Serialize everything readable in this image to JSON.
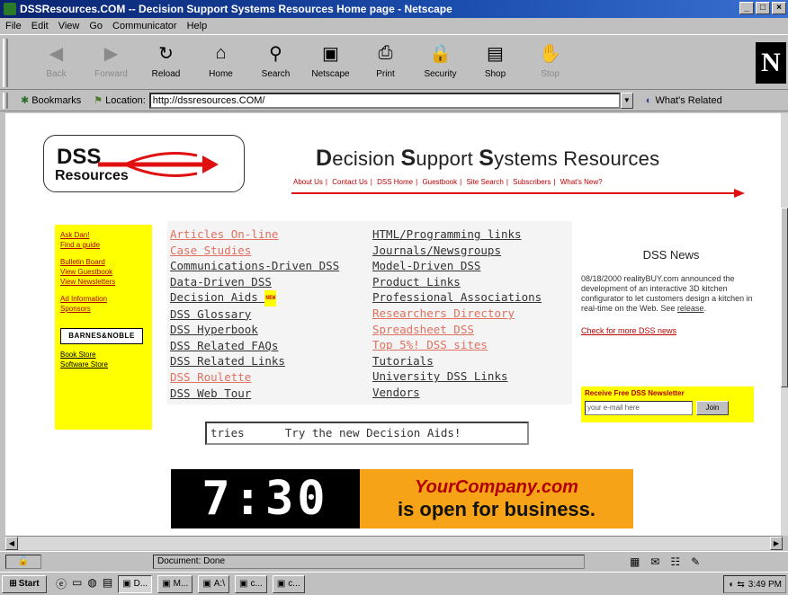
{
  "window": {
    "title": "DSSResources.COM -- Decision Support Systems Resources Home page - Netscape",
    "buttons": [
      "_",
      "□",
      "×"
    ]
  },
  "menu": [
    "File",
    "Edit",
    "View",
    "Go",
    "Communicator",
    "Help"
  ],
  "toolbar": {
    "items": [
      {
        "label": "Back",
        "icon": "back-arrow-icon",
        "glyph": "◀",
        "disabled": true
      },
      {
        "label": "Forward",
        "icon": "forward-arrow-icon",
        "glyph": "▶",
        "disabled": true
      },
      {
        "label": "Reload",
        "icon": "reload-icon",
        "glyph": "↻",
        "disabled": false
      },
      {
        "label": "Home",
        "icon": "home-icon",
        "glyph": "⌂",
        "disabled": false
      },
      {
        "label": "Search",
        "icon": "search-icon",
        "glyph": "⚲",
        "disabled": false
      },
      {
        "label": "Netscape",
        "icon": "netscape-icon",
        "glyph": "▣",
        "disabled": false
      },
      {
        "label": "Print",
        "icon": "print-icon",
        "glyph": "⎙",
        "disabled": false
      },
      {
        "label": "Security",
        "icon": "lock-icon",
        "glyph": "🔒",
        "disabled": false
      },
      {
        "label": "Shop",
        "icon": "shop-icon",
        "glyph": "▤",
        "disabled": false
      },
      {
        "label": "Stop",
        "icon": "stop-icon",
        "glyph": "✋",
        "disabled": true
      }
    ],
    "brand": "N"
  },
  "location": {
    "bookmarks_label": "Bookmarks",
    "location_label": "Location:",
    "url": "http://dssresources.COM/",
    "related_label": "What's Related"
  },
  "page": {
    "logo_top": "DSS",
    "logo_bottom": "Resources",
    "title_parts": [
      "D",
      "ecision ",
      "S",
      "upport ",
      "S",
      "ystems Resources"
    ],
    "topnav": [
      "About Us",
      "Contact Us",
      "DSS Home",
      "Guestbook",
      "Site Search",
      "Subscribers",
      "What's New?"
    ],
    "sidebar_links_a": [
      "Ask Dan!",
      "Find a guide"
    ],
    "sidebar_links_b": [
      "Bulletin Board",
      "View Guestbook",
      "View Newsletters"
    ],
    "sidebar_links_c": [
      "Ad Information",
      "Sponsors"
    ],
    "bn_logo": "BARNES&NOBLE",
    "sidebar_links_d": [
      "Book Store",
      "Software Store"
    ],
    "col1": [
      {
        "text": "Articles On-line",
        "red": true
      },
      {
        "text": "Case Studies",
        "red": true
      },
      {
        "text": "Communications-Driven DSS",
        "red": false
      },
      {
        "text": "Data-Driven DSS",
        "red": false
      },
      {
        "text": "Decision Aids",
        "red": false,
        "badge": "NEW"
      },
      {
        "text": "DSS Glossary",
        "red": false
      },
      {
        "text": "DSS Hyperbook",
        "red": false
      },
      {
        "text": "DSS Related FAQs",
        "red": false
      },
      {
        "text": "DSS Related Links",
        "red": false
      },
      {
        "text": "DSS Roulette",
        "red": true
      },
      {
        "text": "DSS Web Tour",
        "red": false
      }
    ],
    "col2": [
      {
        "text": "HTML/Programming links",
        "red": false
      },
      {
        "text": "Journals/Newsgroups",
        "red": false
      },
      {
        "text": "Model-Driven DSS",
        "red": false
      },
      {
        "text": "Product Links",
        "red": false
      },
      {
        "text": "Professional Associations",
        "red": false
      },
      {
        "text": "Researchers Directory",
        "red": true
      },
      {
        "text": "Spreadsheet DSS",
        "red": true
      },
      {
        "text": "Top 5%! DSS sites",
        "red": true
      },
      {
        "text": "Tutorials",
        "red": false
      },
      {
        "text": "University DSS Links",
        "red": false
      },
      {
        "text": "Vendors",
        "red": false
      }
    ],
    "ticker": "tries      Try the new Decision Aids!",
    "news_title": "DSS News",
    "news_body": "08/18/2000 realityBUY.com announced the development of an interactive 3D kitchen configurator to let customers design a kitchen in real-time on the Web. See",
    "news_link": "release",
    "news_more": "Check for more DSS news",
    "newsletter_title": "Receive Free DSS Newsletter",
    "newsletter_placeholder": "your e-mail here",
    "newsletter_button": "Join",
    "banner_time": "7:30",
    "banner_company": "YourCompany.com",
    "banner_tagline": "is open for business."
  },
  "status": {
    "text": "Document: Done"
  },
  "taskbar": {
    "start": "Start",
    "tasks": [
      "D...",
      "M...",
      "A:\\",
      "c...",
      "c..."
    ],
    "clock": "3:49 PM"
  },
  "colors": {
    "accent_red": "#c00000",
    "highlight_yellow": "#ffff00",
    "banner_orange": "#f6a317"
  }
}
